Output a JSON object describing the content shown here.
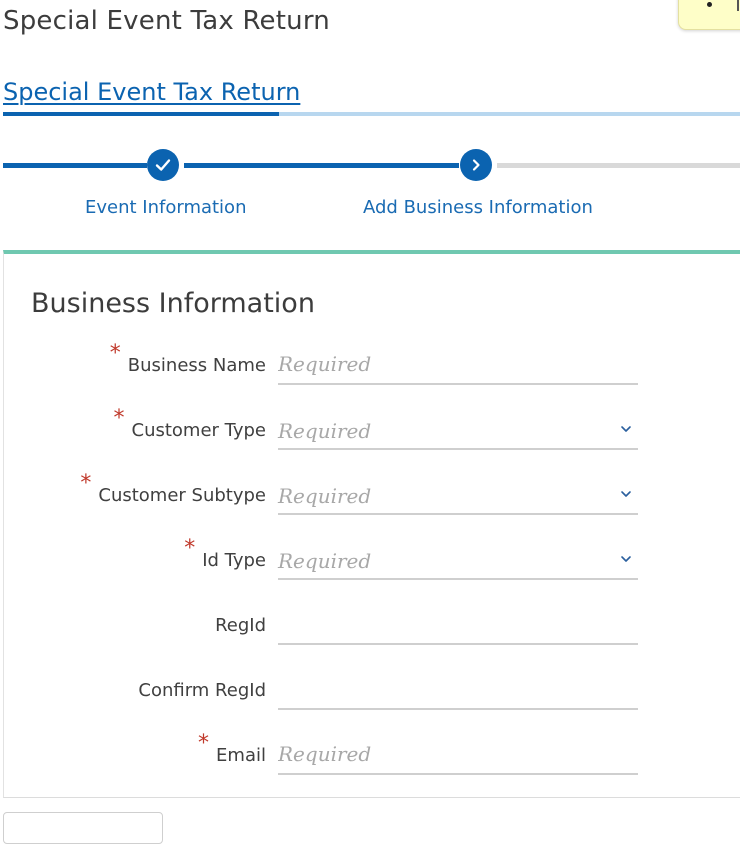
{
  "page": {
    "title": "Special Event Tax Return"
  },
  "subnav": {
    "active_label": "Special Event Tax Return"
  },
  "stepper": {
    "steps": [
      {
        "label": "Event Information",
        "state": "complete",
        "icon": "check-icon"
      },
      {
        "label": "Add Business Information",
        "state": "current",
        "icon": "chevron-right-icon"
      }
    ]
  },
  "form": {
    "title": "Business Information",
    "fields": [
      {
        "label": "Business Name",
        "required": true,
        "type": "text",
        "placeholder": "Required",
        "value": ""
      },
      {
        "label": "Customer Type",
        "required": true,
        "type": "select",
        "placeholder": "Required",
        "value": ""
      },
      {
        "label": "Customer Subtype",
        "required": true,
        "type": "select",
        "placeholder": "Required",
        "value": ""
      },
      {
        "label": "Id Type",
        "required": true,
        "type": "select",
        "placeholder": "Required",
        "value": ""
      },
      {
        "label": "RegId",
        "required": false,
        "type": "text",
        "placeholder": "",
        "value": ""
      },
      {
        "label": "Confirm RegId",
        "required": false,
        "type": "text",
        "placeholder": "",
        "value": ""
      },
      {
        "label": "Email",
        "required": true,
        "type": "text",
        "placeholder": "Required",
        "value": ""
      }
    ],
    "required_marker": "*"
  },
  "colors": {
    "primary": "#0b63b0",
    "link": "#1a6bb3",
    "card_accent": "#6fc8b0",
    "required": "#c0392b",
    "step_inactive": "#d9d9d9"
  }
}
